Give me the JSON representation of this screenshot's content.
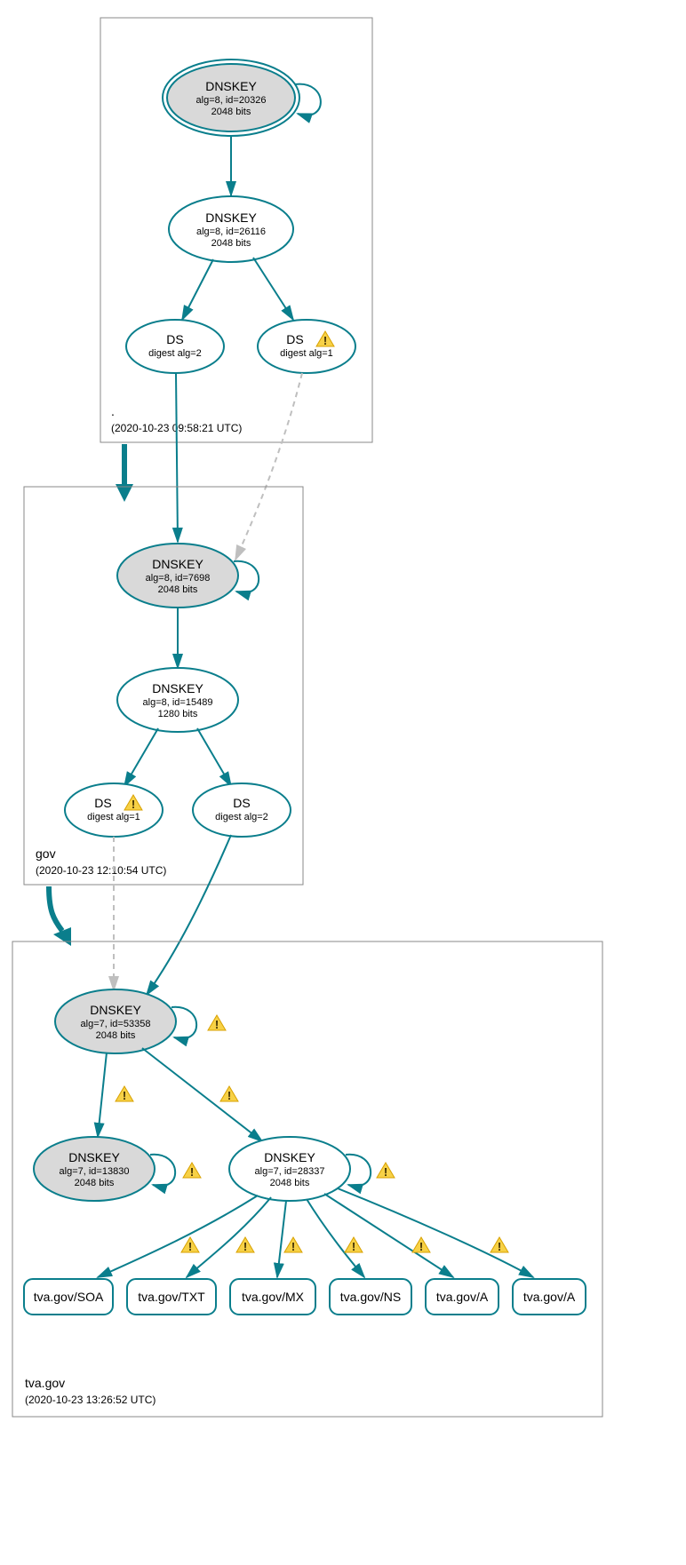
{
  "colors": {
    "stroke": "#0a7e8c",
    "fill_key": "#d9d9d9",
    "edge_dash": "#bfbfbf",
    "warn_fill": "#f7d146",
    "warn_stroke": "#d8a100"
  },
  "zones": {
    "root": {
      "label": ".",
      "timestamp": "(2020-10-23 09:58:21 UTC)"
    },
    "gov": {
      "label": "gov",
      "timestamp": "(2020-10-23 12:10:54 UTC)"
    },
    "tva": {
      "label": "tva.gov",
      "timestamp": "(2020-10-23 13:26:52 UTC)"
    }
  },
  "nodes": {
    "root_ksk": {
      "title": "DNSKEY",
      "line2": "alg=8, id=20326",
      "line3": "2048 bits"
    },
    "root_zsk": {
      "title": "DNSKEY",
      "line2": "alg=8, id=26116",
      "line3": "2048 bits"
    },
    "root_ds2": {
      "title": "DS",
      "line2": "digest alg=2"
    },
    "root_ds1": {
      "title": "DS",
      "line2": "digest alg=1"
    },
    "gov_ksk": {
      "title": "DNSKEY",
      "line2": "alg=8, id=7698",
      "line3": "2048 bits"
    },
    "gov_zsk": {
      "title": "DNSKEY",
      "line2": "alg=8, id=15489",
      "line3": "1280 bits"
    },
    "gov_ds1": {
      "title": "DS",
      "line2": "digest alg=1"
    },
    "gov_ds2": {
      "title": "DS",
      "line2": "digest alg=2"
    },
    "tva_ksk": {
      "title": "DNSKEY",
      "line2": "alg=7, id=53358",
      "line3": "2048 bits"
    },
    "tva_k2": {
      "title": "DNSKEY",
      "line2": "alg=7, id=13830",
      "line3": "2048 bits"
    },
    "tva_zsk": {
      "title": "DNSKEY",
      "line2": "alg=7, id=28337",
      "line3": "2048 bits"
    },
    "rr_soa": {
      "label": "tva.gov/SOA"
    },
    "rr_txt": {
      "label": "tva.gov/TXT"
    },
    "rr_mx": {
      "label": "tva.gov/MX"
    },
    "rr_ns": {
      "label": "tva.gov/NS"
    },
    "rr_a1": {
      "label": "tva.gov/A"
    },
    "rr_a2": {
      "label": "tva.gov/A"
    }
  }
}
